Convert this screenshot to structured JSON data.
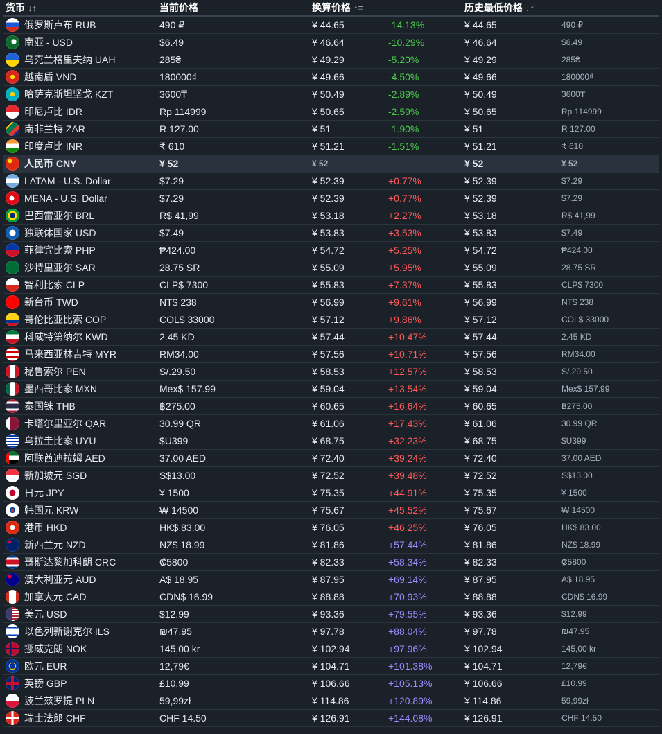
{
  "header": {
    "currency": "货币",
    "current_price": "当前价格",
    "converted_price": "换算价格",
    "lowest_price": "历史最低价格",
    "sort_both": "↓↑",
    "sort_asc": "↑≡"
  },
  "rows": [
    {
      "name": "俄罗斯卢布 RUB",
      "price": "490 ₽",
      "conv": "¥ 44.65",
      "pct": "-14.13%",
      "low": "¥ 44.65",
      "lowp": "490 ₽",
      "flag": "linear-gradient(#ffffff 0 33%, #1c57d6 33% 66%, #d52b1e 66%)",
      "pc": "neg"
    },
    {
      "name": "南亚 - USD",
      "price": "$6.49",
      "conv": "¥ 46.64",
      "pct": "-10.29%",
      "low": "¥ 46.64",
      "lowp": "$6.49",
      "flag": "radial-gradient(circle at 60% 45%, #ffffff 0 22%, #0a6b2b 23%)",
      "pc": "neg"
    },
    {
      "name": "乌克兰格里夫纳 UAH",
      "price": "285₴",
      "conv": "¥ 49.29",
      "pct": "-5.20%",
      "low": "¥ 49.29",
      "lowp": "285₴",
      "flag": "linear-gradient(#1f64d6 0 50%, #ffd500 50%)",
      "pc": "neg"
    },
    {
      "name": "越南盾 VND",
      "price": "180000₫",
      "conv": "¥ 49.66",
      "pct": "-4.50%",
      "low": "¥ 49.66",
      "lowp": "180000₫",
      "flag": "radial-gradient(circle, #ffdd00 0 22%, #da251d 24%)",
      "pc": "neg"
    },
    {
      "name": "哈萨克斯坦坚戈 KZT",
      "price": "3600₸",
      "conv": "¥ 50.49",
      "pct": "-2.89%",
      "low": "¥ 50.49",
      "lowp": "3600₸",
      "flag": "radial-gradient(circle, #ffd200 0 22%, #00afca 24%)",
      "pc": "neg"
    },
    {
      "name": "印尼卢比 IDR",
      "price": "Rp 114999",
      "conv": "¥ 50.65",
      "pct": "-2.59%",
      "low": "¥ 50.65",
      "lowp": "Rp 114999",
      "flag": "linear-gradient(#e7272d 0 50%, #ffffff 50%)",
      "pc": "neg"
    },
    {
      "name": "南非兰特 ZAR",
      "price": "R 127.00",
      "conv": "¥ 51",
      "pct": "-1.90%",
      "low": "¥ 51",
      "lowp": "R 127.00",
      "flag": "linear-gradient(135deg, #000 0 22%, #ffb81c 22% 30%, #007a4d 30% 55%, #de3831 55% 75%, #002395 75%)",
      "pc": "neg"
    },
    {
      "name": "印度卢比 INR",
      "price": "₹ 610",
      "conv": "¥ 51.21",
      "pct": "-1.51%",
      "low": "¥ 51.21",
      "lowp": "₹ 610",
      "flag": "linear-gradient(#ff9933 0 33%, #ffffff 33% 66%, #138808 66%)",
      "pc": "neg"
    },
    {
      "name": "人民币 CNY",
      "price": "¥ 52",
      "conv": "¥ 52",
      "pct": "",
      "low": "¥ 52",
      "lowp": "¥ 52",
      "flag": "radial-gradient(circle at 32% 32%, #ffde00 0 14%, #de2910 16%)",
      "pc": "neg",
      "hl": true
    },
    {
      "name": "LATAM - U.S. Dollar",
      "price": "$7.29",
      "conv": "¥ 52.39",
      "pct": "+0.77%",
      "low": "¥ 52.39",
      "lowp": "$7.29",
      "flag": "linear-gradient(#74acdf 0 33%, #ffffff 33% 66%, #74acdf 66%)",
      "pc": "pos"
    },
    {
      "name": "MENA - U.S. Dollar",
      "price": "$7.29",
      "conv": "¥ 52.39",
      "pct": "+0.77%",
      "low": "¥ 52.39",
      "lowp": "$7.29",
      "flag": "radial-gradient(circle at 45% 50%, #ffffff 0 22%, #e30a17 24%)",
      "pc": "pos"
    },
    {
      "name": "巴西雷亚尔 BRL",
      "price": "R$ 41,99",
      "conv": "¥ 53.18",
      "pct": "+2.27%",
      "low": "¥ 53.18",
      "lowp": "R$ 41,99",
      "flag": "radial-gradient(circle, #002776 0 25%, #ffdf00 26% 45%, #009c3b 46%)",
      "pc": "pos"
    },
    {
      "name": "独联体国家 USD",
      "price": "$7.49",
      "conv": "¥ 53.83",
      "pct": "+3.53%",
      "low": "¥ 53.83",
      "lowp": "$7.49",
      "flag": "radial-gradient(circle, #ffffff 0 30%, #0d5eb4 32%)",
      "pc": "pos"
    },
    {
      "name": "菲律宾比索 PHP",
      "price": "₱424.00",
      "conv": "¥ 54.72",
      "pct": "+5.25%",
      "low": "¥ 54.72",
      "lowp": "₱424.00",
      "flag": "linear-gradient(#0038a8 0 50%, #ce1126 50%)",
      "pc": "pos"
    },
    {
      "name": "沙特里亚尔 SAR",
      "price": "28.75 SR",
      "conv": "¥ 55.09",
      "pct": "+5.95%",
      "low": "¥ 55.09",
      "lowp": "28.75 SR",
      "flag": "linear-gradient(#006c35, #006c35)",
      "pc": "pos"
    },
    {
      "name": "智利比索 CLP",
      "price": "CLP$ 7300",
      "conv": "¥ 55.83",
      "pct": "+7.37%",
      "low": "¥ 55.83",
      "lowp": "CLP$ 7300",
      "flag": "linear-gradient(#ffffff 0 50%, #d52b1e 50%)",
      "pc": "pos"
    },
    {
      "name": "新台币 TWD",
      "price": "NT$ 238",
      "conv": "¥ 56.99",
      "pct": "+9.61%",
      "low": "¥ 56.99",
      "lowp": "NT$ 238",
      "flag": "linear-gradient(#fe0000, #fe0000)",
      "pc": "pos"
    },
    {
      "name": "哥伦比亚比索 COP",
      "price": "COL$ 33000",
      "conv": "¥ 57.12",
      "pct": "+9.86%",
      "low": "¥ 57.12",
      "lowp": "COL$ 33000",
      "flag": "linear-gradient(#fcd116 0 50%, #003893 50% 75%, #ce1126 75%)",
      "pc": "pos"
    },
    {
      "name": "科威特第纳尔 KWD",
      "price": "2.45 KD",
      "conv": "¥ 57.44",
      "pct": "+10.47%",
      "low": "¥ 57.44",
      "lowp": "2.45 KD",
      "flag": "linear-gradient(#007a3d 0 33%, #ffffff 33% 66%, #ce1126 66%)",
      "pc": "pos"
    },
    {
      "name": "马来西亚林吉特 MYR",
      "price": "RM34.00",
      "conv": "¥ 57.56",
      "pct": "+10.71%",
      "low": "¥ 57.56",
      "lowp": "RM34.00",
      "flag": "repeating-linear-gradient(#cc0001 0 3px, #ffffff 3px 6px)",
      "pc": "pos"
    },
    {
      "name": "秘鲁索尔 PEN",
      "price": "S/.29.50",
      "conv": "¥ 58.53",
      "pct": "+12.57%",
      "low": "¥ 58.53",
      "lowp": "S/.29.50",
      "flag": "linear-gradient(90deg, #d91023 0 33%, #ffffff 33% 66%, #d91023 66%)",
      "pc": "pos"
    },
    {
      "name": "墨西哥比索 MXN",
      "price": "Mex$ 157.99",
      "conv": "¥ 59.04",
      "pct": "+13.54%",
      "low": "¥ 59.04",
      "lowp": "Mex$ 157.99",
      "flag": "linear-gradient(90deg, #006847 0 33%, #ffffff 33% 66%, #ce1126 66%)",
      "pc": "pos"
    },
    {
      "name": "泰国铢 THB",
      "price": "฿275.00",
      "conv": "¥ 60.65",
      "pct": "+16.64%",
      "low": "¥ 60.65",
      "lowp": "฿275.00",
      "flag": "linear-gradient(#a51931 0 17%, #ffffff 17% 33%, #2d2a4a 33% 67%, #ffffff 67% 83%, #a51931 83%)",
      "pc": "pos"
    },
    {
      "name": "卡塔尔里亚尔 QAR",
      "price": "30.99 QR",
      "conv": "¥ 61.06",
      "pct": "+17.43%",
      "low": "¥ 61.06",
      "lowp": "30.99 QR",
      "flag": "linear-gradient(90deg, #ffffff 0 35%, #8a1538 35%)",
      "pc": "pos"
    },
    {
      "name": "乌拉圭比索 UYU",
      "price": "$U399",
      "conv": "¥ 68.75",
      "pct": "+32.23%",
      "low": "¥ 68.75",
      "lowp": "$U399",
      "flag": "repeating-linear-gradient(#ffffff 0 2px, #0038a8 2px 4px)",
      "pc": "pos"
    },
    {
      "name": "阿联酋迪拉姆 AED",
      "price": "37.00 AED",
      "conv": "¥ 72.40",
      "pct": "+39.24%",
      "low": "¥ 72.40",
      "lowp": "37.00 AED",
      "flag": "linear-gradient(90deg, #ff0000 0 25%, transparent 25%), linear-gradient(#00732f 0 33%, #ffffff 33% 66%, #000000 66%)",
      "pc": "pos"
    },
    {
      "name": "新加坡元 SGD",
      "price": "S$13.00",
      "conv": "¥ 72.52",
      "pct": "+39.48%",
      "low": "¥ 72.52",
      "lowp": "S$13.00",
      "flag": "linear-gradient(#ef3340 0 50%, #ffffff 50%)",
      "pc": "pos"
    },
    {
      "name": "日元 JPY",
      "price": "¥ 1500",
      "conv": "¥ 75.35",
      "pct": "+44.91%",
      "low": "¥ 75.35",
      "lowp": "¥ 1500",
      "flag": "radial-gradient(circle, #bc002d 0 30%, #ffffff 32%)",
      "pc": "pos"
    },
    {
      "name": "韩国元 KRW",
      "price": "₩ 14500",
      "conv": "¥ 75.67",
      "pct": "+45.52%",
      "low": "¥ 75.67",
      "lowp": "₩ 14500",
      "flag": "radial-gradient(circle, #cd2e3a 0 15%, #0047a0 16% 28%, #ffffff 30%)",
      "pc": "pos"
    },
    {
      "name": "港币 HKD",
      "price": "HK$ 83.00",
      "conv": "¥ 76.05",
      "pct": "+46.25%",
      "low": "¥ 76.05",
      "lowp": "HK$ 83.00",
      "flag": "radial-gradient(circle, #ffffff 0 22%, #de2910 24%)",
      "pc": "pos"
    },
    {
      "name": "新西兰元 NZD",
      "price": "NZ$ 18.99",
      "conv": "¥ 81.86",
      "pct": "+57.44%",
      "low": "¥ 81.86",
      "lowp": "NZ$ 18.99",
      "flag": "radial-gradient(circle at 30% 30%, #c8102e 0 12%, #012169 14%)",
      "pc": "big"
    },
    {
      "name": "哥斯达黎加科朗 CRC",
      "price": "₡5800",
      "conv": "¥ 82.33",
      "pct": "+58.34%",
      "low": "¥ 82.33",
      "lowp": "₡5800",
      "flag": "linear-gradient(#002b7f 0 17%, #ffffff 17% 33%, #ce1126 33% 67%, #ffffff 67% 83%, #002b7f 83%)",
      "pc": "big"
    },
    {
      "name": "澳大利亚元 AUD",
      "price": "A$ 18.95",
      "conv": "¥ 87.95",
      "pct": "+69.14%",
      "low": "¥ 87.95",
      "lowp": "A$ 18.95",
      "flag": "radial-gradient(circle at 30% 30%, #e4002b 0 12%, #00008b 14%)",
      "pc": "big"
    },
    {
      "name": "加拿大元 CAD",
      "price": "CDN$ 16.99",
      "conv": "¥ 88.88",
      "pct": "+70.93%",
      "low": "¥ 88.88",
      "lowp": "CDN$ 16.99",
      "flag": "linear-gradient(90deg, #d52b1e 0 25%, #ffffff 25% 75%, #d52b1e 75%)",
      "pc": "big"
    },
    {
      "name": "美元 USD",
      "price": "$12.99",
      "conv": "¥ 93.36",
      "pct": "+79.55%",
      "low": "¥ 93.36",
      "lowp": "$12.99",
      "flag": "linear-gradient(90deg, #3c3b6e 0 45%, transparent 45%), repeating-linear-gradient(#b22234 0 2px, #ffffff 2px 4px)",
      "pc": "big"
    },
    {
      "name": "以色列新谢克尔 ILS",
      "price": "₪47.95",
      "conv": "¥ 97.78",
      "pct": "+88.04%",
      "low": "¥ 97.78",
      "lowp": "₪47.95",
      "flag": "linear-gradient(#ffffff 0 18%, #0038b8 18% 28%, #ffffff 28% 72%, #0038b8 72% 82%, #ffffff 82%)",
      "pc": "big"
    },
    {
      "name": "挪威克朗 NOK",
      "price": "145,00 kr",
      "conv": "¥ 102.94",
      "pct": "+97.96%",
      "low": "¥ 102.94",
      "lowp": "145,00 kr",
      "flag": "linear-gradient(90deg, transparent 0 30%, #00205b 30% 42%, transparent 42%), linear-gradient(transparent 0 44%, #00205b 44% 56%, transparent 56%), #ba0c2f",
      "pc": "big"
    },
    {
      "name": "欧元 EUR",
      "price": "12,79€",
      "conv": "¥ 104.71",
      "pct": "+101.38%",
      "low": "¥ 104.71",
      "lowp": "12,79€",
      "flag": "radial-gradient(circle, #003399 0 28%, #ffcc00 30% 36%, #003399 38%)",
      "pc": "big"
    },
    {
      "name": "英镑 GBP",
      "price": "£10.99",
      "conv": "¥ 106.66",
      "pct": "+105.13%",
      "low": "¥ 106.66",
      "lowp": "£10.99",
      "flag": "linear-gradient(90deg, transparent 0 40%, #c8102e 40% 60%, transparent 60%), linear-gradient(transparent 0 40%, #c8102e 40% 60%, transparent 60%), #012169",
      "pc": "big"
    },
    {
      "name": "波兰兹罗提 PLN",
      "price": "59,99zł",
      "conv": "¥ 114.86",
      "pct": "+120.89%",
      "low": "¥ 114.86",
      "lowp": "59,99zł",
      "flag": "linear-gradient(#ffffff 0 50%, #dc143c 50%)",
      "pc": "big"
    },
    {
      "name": "瑞士法郎 CHF",
      "price": "CHF 14.50",
      "conv": "¥ 126.91",
      "pct": "+144.08%",
      "low": "¥ 126.91",
      "lowp": "CHF 14.50",
      "flag": "linear-gradient(90deg, transparent 0 42%, #ffffff 42% 58%, transparent 58%), linear-gradient(transparent 0 42%, #ffffff 42% 58%, transparent 58%), #da291c",
      "pc": "big"
    }
  ]
}
